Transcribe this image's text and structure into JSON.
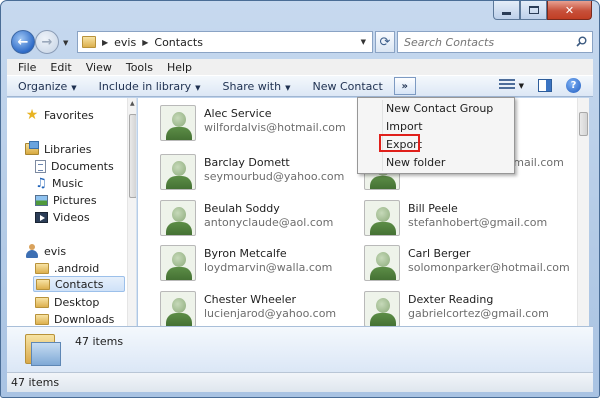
{
  "titlebar": {
    "min_icon": "minimize-icon",
    "max_icon": "maximize-icon",
    "close_icon": "close-icon",
    "close_glyph": "✕"
  },
  "address": {
    "crumbs": [
      "evis",
      "Contacts"
    ],
    "separator": "▶",
    "refresh_glyph": "⟳",
    "search_placeholder": "Search Contacts"
  },
  "menubar": [
    "File",
    "Edit",
    "View",
    "Tools",
    "Help"
  ],
  "toolbar": {
    "organize": "Organize",
    "include_in_library": "Include in library",
    "share_with": "Share with",
    "new_contact": "New Contact",
    "more": "»",
    "help_glyph": "?"
  },
  "dropdown": {
    "items": [
      "New Contact Group",
      "Import",
      "Export",
      "New folder"
    ],
    "highlight_color": "#e0201b"
  },
  "navpane": {
    "favorites": "Favorites",
    "libraries": "Libraries",
    "lib_items": [
      "Documents",
      "Music",
      "Pictures",
      "Videos"
    ],
    "user": "evis",
    "user_items": [
      ".android",
      "Contacts",
      "Desktop",
      "Downloads"
    ],
    "selected": "Contacts"
  },
  "contacts": [
    {
      "name": "Alec Service",
      "email": "wilfordalvis@hotmail.com"
    },
    {
      "name": "",
      "email": ""
    },
    {
      "name": "Barclay Domett",
      "email": "seymourbud@yahoo.com"
    },
    {
      "name": "",
      "email": "leopoldotruman@gmail.com"
    },
    {
      "name": "Beulah Soddy",
      "email": "antonyclaude@aol.com"
    },
    {
      "name": "Bill Peele",
      "email": "stefanhobert@gmail.com"
    },
    {
      "name": "Byron Metcalfe",
      "email": "loydmarvin@walla.com"
    },
    {
      "name": "Carl Berger",
      "email": "solomonparker@hotmail.com"
    },
    {
      "name": "Chester Wheeler",
      "email": "lucienjarod@yahoo.com"
    },
    {
      "name": "Dexter Reading",
      "email": "gabrielcortez@gmail.com"
    }
  ],
  "details": {
    "count": "47 items"
  },
  "status": {
    "count": "47 items"
  }
}
